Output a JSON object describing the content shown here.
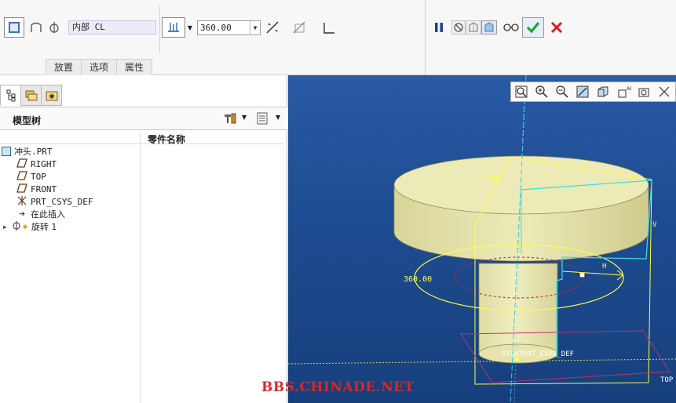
{
  "dashboard": {
    "type_field": "内部 CL",
    "angle": "360.00",
    "tabs": [
      "放置",
      "选项",
      "属性"
    ]
  },
  "icons": {
    "solid": "solid-icon",
    "surface": "surface-icon",
    "axis": "axis-icon",
    "flip": "flip-direction-icon",
    "remove_material": "remove-material-icon",
    "thicken": "thicken-icon",
    "pause": "pause-icon",
    "confirm": "checkmark-icon",
    "cancel": "close-icon"
  },
  "navigator": {
    "tabs": [
      "model-tree",
      "folder-browser",
      "favorites"
    ],
    "title": "模型树",
    "column_header": "零件名称",
    "items": [
      {
        "label": "冲头.PRT",
        "icon": "part-icon"
      },
      {
        "label": "RIGHT",
        "icon": "datum-plane-icon"
      },
      {
        "label": "TOP",
        "icon": "datum-plane-icon"
      },
      {
        "label": "FRONT",
        "icon": "datum-plane-icon"
      },
      {
        "label": "PRT_CSYS_DEF",
        "icon": "csys-icon"
      },
      {
        "label": "在此插入",
        "icon": "insert-arrow-icon"
      },
      {
        "label": "旋转 1",
        "icon": "revolve-icon"
      }
    ]
  },
  "graphics": {
    "labels": {
      "angle": "360.00",
      "front": "FRONT",
      "top": "TOP",
      "right_csys": "RIGHT",
      "csys": "PRT_CSYS_DEF",
      "v": "V",
      "h": "H"
    }
  },
  "watermark": "BBS.CHINADE.NET",
  "colors": {
    "background_top": "#2a5aa4",
    "background_bottom": "#163f7c",
    "part": "#e8e6b0",
    "datum": "#ffff44",
    "csys": "#38e0e0",
    "confirm": "#1aa43a",
    "cancel": "#d42020"
  }
}
